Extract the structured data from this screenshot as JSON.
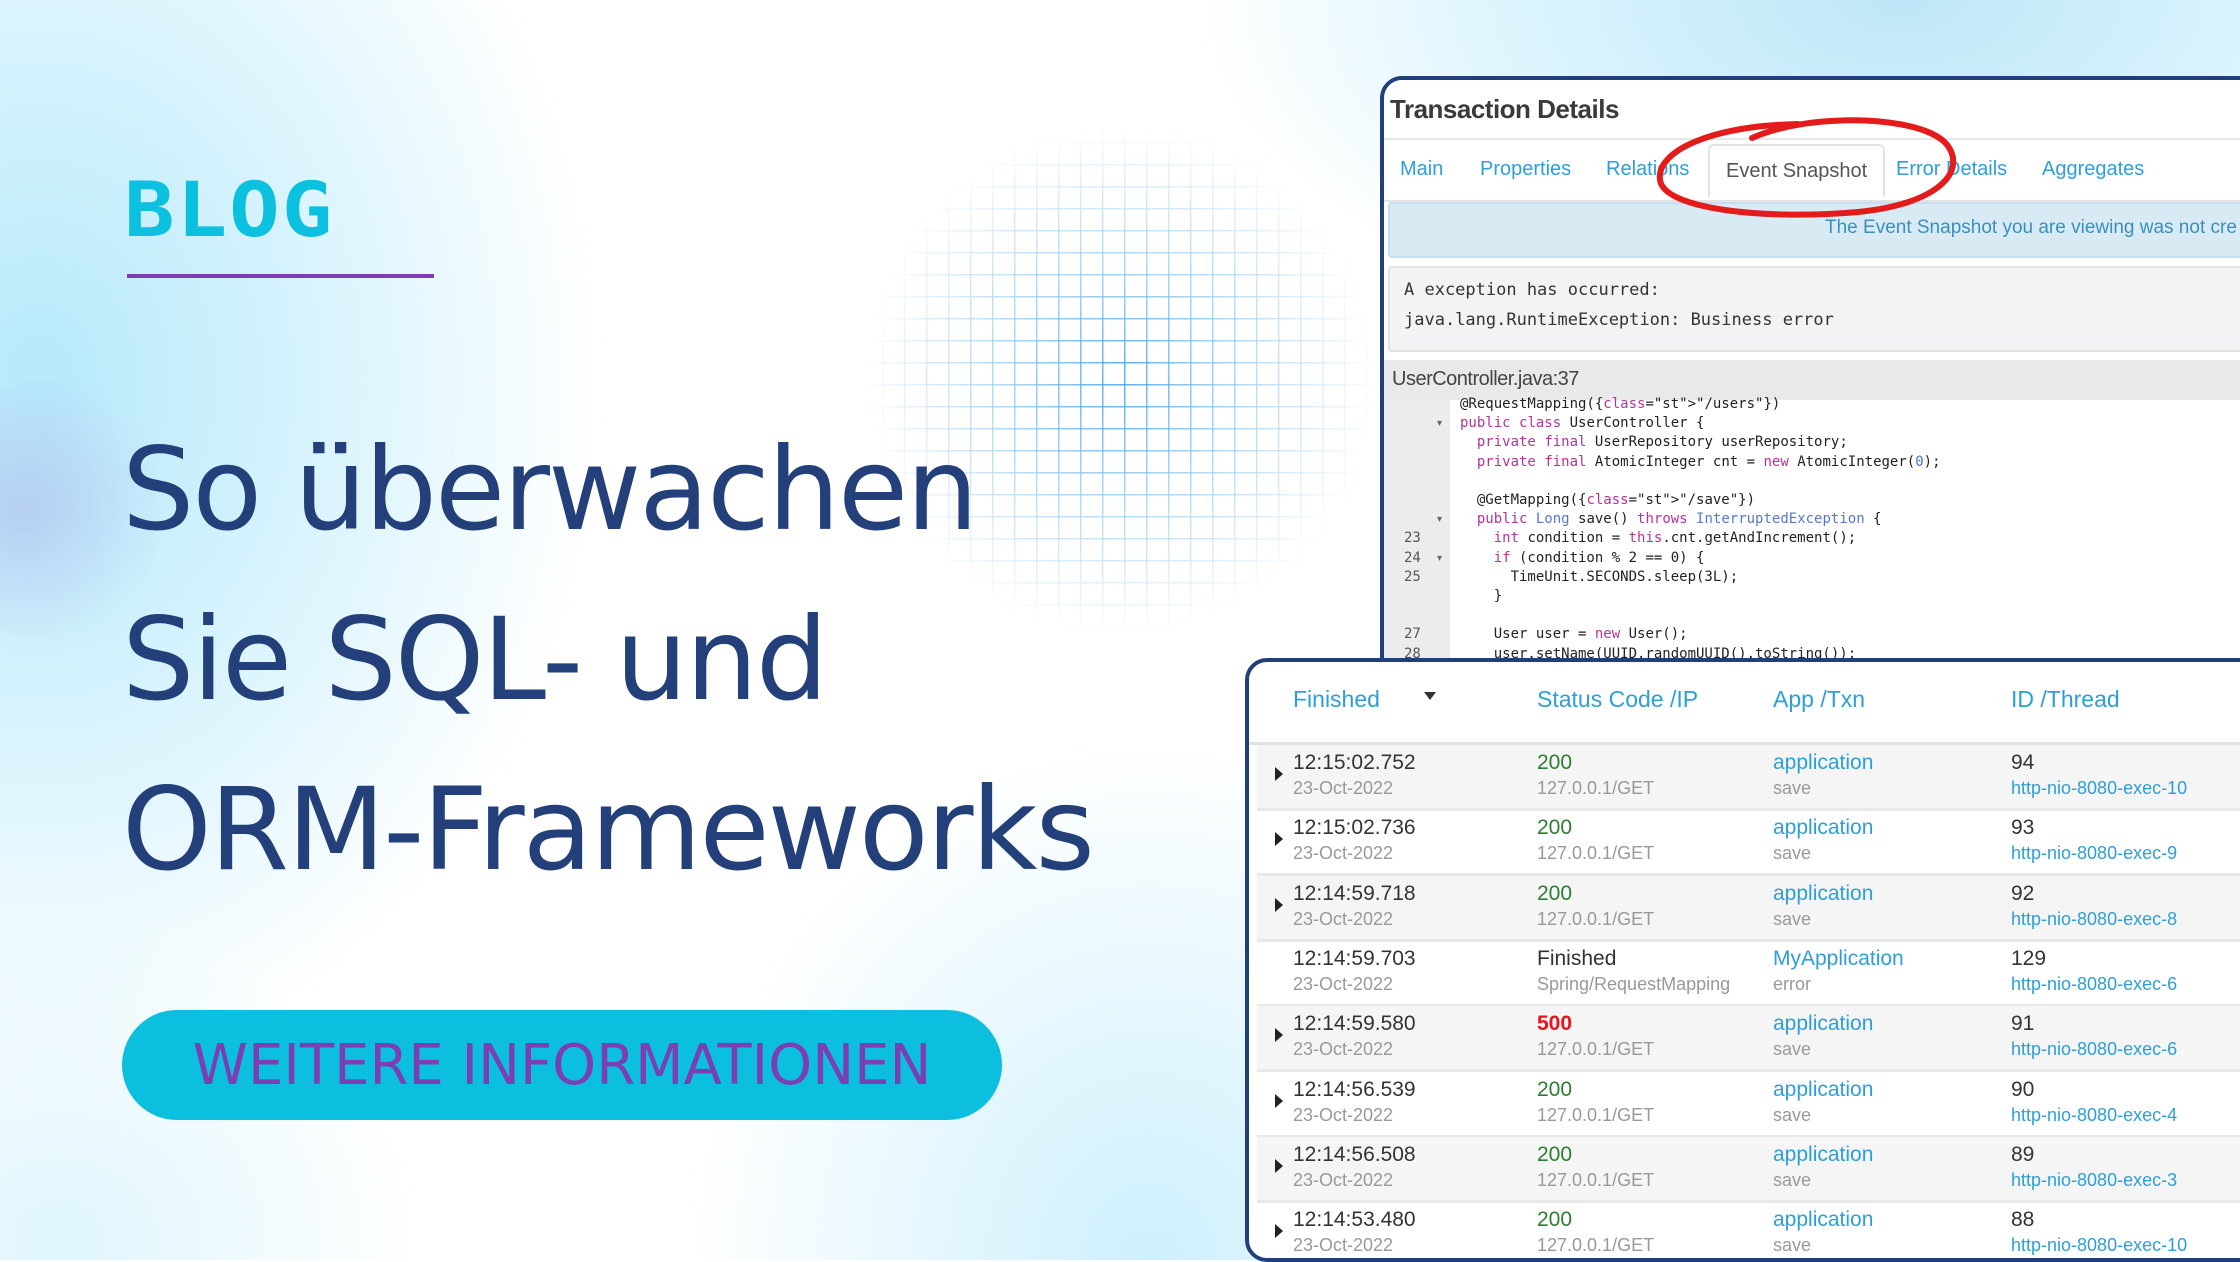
{
  "blog_label": "BLOG",
  "headline": [
    "So überwachen",
    "Sie SQL- und",
    "ORM-Frameworks"
  ],
  "cta_label": "WEITERE INFORMATIONEN",
  "colors": {
    "accent_cyan": "#0dbfdf",
    "accent_purple": "#7b3fb3",
    "navy": "#24407a",
    "link_blue": "#2d9fd8",
    "ok_green": "#2e7d32",
    "error_red": "#e8141b"
  },
  "transaction_panel": {
    "title": "Transaction Details",
    "tabs": [
      {
        "label": "Main",
        "active": false
      },
      {
        "label": "Properties",
        "active": false
      },
      {
        "label": "Relations",
        "active": false
      },
      {
        "label": "Event Snapshot",
        "active": true
      },
      {
        "label": "Error Details",
        "active": false
      },
      {
        "label": "Aggregates",
        "active": false
      }
    ],
    "banner": "The Event Snapshot you are viewing was not cre",
    "exception_lines": [
      "A exception has occurred:",
      "java.lang.RuntimeException: Business error"
    ],
    "source_file": "UserController.java:37",
    "code_lines": [
      {
        "n": "",
        "fold": false,
        "text": "@RequestMapping({\"/users\"})"
      },
      {
        "n": "",
        "fold": true,
        "text": "public class UserController {"
      },
      {
        "n": "",
        "fold": false,
        "text": "  private final UserRepository userRepository;"
      },
      {
        "n": "",
        "fold": false,
        "text": "  private final AtomicInteger cnt = new AtomicInteger(0);"
      },
      {
        "n": "",
        "fold": false,
        "text": ""
      },
      {
        "n": "",
        "fold": false,
        "text": "  @GetMapping({\"/save\"})"
      },
      {
        "n": "",
        "fold": true,
        "text": "  public Long save() throws InterruptedException {"
      },
      {
        "n": "23",
        "fold": false,
        "text": "    int condition = this.cnt.getAndIncrement();"
      },
      {
        "n": "24",
        "fold": true,
        "text": "    if (condition % 2 == 0) {"
      },
      {
        "n": "25",
        "fold": false,
        "text": "      TimeUnit.SECONDS.sleep(3L);"
      },
      {
        "n": "",
        "fold": false,
        "text": "    }"
      },
      {
        "n": "",
        "fold": false,
        "text": ""
      },
      {
        "n": "27",
        "fold": false,
        "text": "    User user = new User();"
      },
      {
        "n": "28",
        "fold": false,
        "text": "    user.setName(UUID.randomUUID().toString());"
      }
    ]
  },
  "transactions_table": {
    "columns": [
      "Finished",
      "Status Code /IP",
      "App /Txn",
      "ID /Thread"
    ],
    "sort_column": "Finished",
    "rows": [
      {
        "time": "12:15:02.752",
        "date": "23-Oct-2022",
        "status": "200",
        "status_type": "ok",
        "ip": "127.0.0.1/GET",
        "app": "application",
        "txn": "save",
        "id": "94",
        "thread": "http-nio-8080-exec-10",
        "expandable": true
      },
      {
        "time": "12:15:02.736",
        "date": "23-Oct-2022",
        "status": "200",
        "status_type": "ok",
        "ip": "127.0.0.1/GET",
        "app": "application",
        "txn": "save",
        "id": "93",
        "thread": "http-nio-8080-exec-9",
        "expandable": true
      },
      {
        "time": "12:14:59.718",
        "date": "23-Oct-2022",
        "status": "200",
        "status_type": "ok",
        "ip": "127.0.0.1/GET",
        "app": "application",
        "txn": "save",
        "id": "92",
        "thread": "http-nio-8080-exec-8",
        "expandable": true
      },
      {
        "time": "12:14:59.703",
        "date": "23-Oct-2022",
        "status": "Finished",
        "status_type": "neutral",
        "ip": "Spring/RequestMapping",
        "app": "MyApplication",
        "txn": "error",
        "id": "129",
        "thread": "http-nio-8080-exec-6",
        "expandable": false
      },
      {
        "time": "12:14:59.580",
        "date": "23-Oct-2022",
        "status": "500",
        "status_type": "error",
        "ip": "127.0.0.1/GET",
        "app": "application",
        "txn": "save",
        "id": "91",
        "thread": "http-nio-8080-exec-6",
        "expandable": true
      },
      {
        "time": "12:14:56.539",
        "date": "23-Oct-2022",
        "status": "200",
        "status_type": "ok",
        "ip": "127.0.0.1/GET",
        "app": "application",
        "txn": "save",
        "id": "90",
        "thread": "http-nio-8080-exec-4",
        "expandable": true
      },
      {
        "time": "12:14:56.508",
        "date": "23-Oct-2022",
        "status": "200",
        "status_type": "ok",
        "ip": "127.0.0.1/GET",
        "app": "application",
        "txn": "save",
        "id": "89",
        "thread": "http-nio-8080-exec-3",
        "expandable": true
      },
      {
        "time": "12:14:53.480",
        "date": "23-Oct-2022",
        "status": "200",
        "status_type": "ok",
        "ip": "127.0.0.1/GET",
        "app": "application",
        "txn": "save",
        "id": "88",
        "thread": "http-nio-8080-exec-10",
        "expandable": true
      }
    ]
  }
}
